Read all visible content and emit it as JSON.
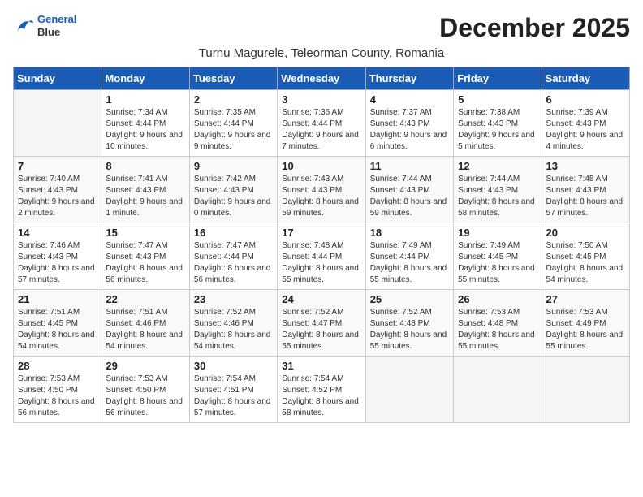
{
  "logo": {
    "line1": "General",
    "line2": "Blue"
  },
  "title": "December 2025",
  "location": "Turnu Magurele, Teleorman County, Romania",
  "weekdays": [
    "Sunday",
    "Monday",
    "Tuesday",
    "Wednesday",
    "Thursday",
    "Friday",
    "Saturday"
  ],
  "weeks": [
    [
      {
        "day": "",
        "sunrise": "",
        "sunset": "",
        "daylight": ""
      },
      {
        "day": "1",
        "sunrise": "Sunrise: 7:34 AM",
        "sunset": "Sunset: 4:44 PM",
        "daylight": "Daylight: 9 hours and 10 minutes."
      },
      {
        "day": "2",
        "sunrise": "Sunrise: 7:35 AM",
        "sunset": "Sunset: 4:44 PM",
        "daylight": "Daylight: 9 hours and 9 minutes."
      },
      {
        "day": "3",
        "sunrise": "Sunrise: 7:36 AM",
        "sunset": "Sunset: 4:44 PM",
        "daylight": "Daylight: 9 hours and 7 minutes."
      },
      {
        "day": "4",
        "sunrise": "Sunrise: 7:37 AM",
        "sunset": "Sunset: 4:43 PM",
        "daylight": "Daylight: 9 hours and 6 minutes."
      },
      {
        "day": "5",
        "sunrise": "Sunrise: 7:38 AM",
        "sunset": "Sunset: 4:43 PM",
        "daylight": "Daylight: 9 hours and 5 minutes."
      },
      {
        "day": "6",
        "sunrise": "Sunrise: 7:39 AM",
        "sunset": "Sunset: 4:43 PM",
        "daylight": "Daylight: 9 hours and 4 minutes."
      }
    ],
    [
      {
        "day": "7",
        "sunrise": "Sunrise: 7:40 AM",
        "sunset": "Sunset: 4:43 PM",
        "daylight": "Daylight: 9 hours and 2 minutes."
      },
      {
        "day": "8",
        "sunrise": "Sunrise: 7:41 AM",
        "sunset": "Sunset: 4:43 PM",
        "daylight": "Daylight: 9 hours and 1 minute."
      },
      {
        "day": "9",
        "sunrise": "Sunrise: 7:42 AM",
        "sunset": "Sunset: 4:43 PM",
        "daylight": "Daylight: 9 hours and 0 minutes."
      },
      {
        "day": "10",
        "sunrise": "Sunrise: 7:43 AM",
        "sunset": "Sunset: 4:43 PM",
        "daylight": "Daylight: 8 hours and 59 minutes."
      },
      {
        "day": "11",
        "sunrise": "Sunrise: 7:44 AM",
        "sunset": "Sunset: 4:43 PM",
        "daylight": "Daylight: 8 hours and 59 minutes."
      },
      {
        "day": "12",
        "sunrise": "Sunrise: 7:44 AM",
        "sunset": "Sunset: 4:43 PM",
        "daylight": "Daylight: 8 hours and 58 minutes."
      },
      {
        "day": "13",
        "sunrise": "Sunrise: 7:45 AM",
        "sunset": "Sunset: 4:43 PM",
        "daylight": "Daylight: 8 hours and 57 minutes."
      }
    ],
    [
      {
        "day": "14",
        "sunrise": "Sunrise: 7:46 AM",
        "sunset": "Sunset: 4:43 PM",
        "daylight": "Daylight: 8 hours and 57 minutes."
      },
      {
        "day": "15",
        "sunrise": "Sunrise: 7:47 AM",
        "sunset": "Sunset: 4:43 PM",
        "daylight": "Daylight: 8 hours and 56 minutes."
      },
      {
        "day": "16",
        "sunrise": "Sunrise: 7:47 AM",
        "sunset": "Sunset: 4:44 PM",
        "daylight": "Daylight: 8 hours and 56 minutes."
      },
      {
        "day": "17",
        "sunrise": "Sunrise: 7:48 AM",
        "sunset": "Sunset: 4:44 PM",
        "daylight": "Daylight: 8 hours and 55 minutes."
      },
      {
        "day": "18",
        "sunrise": "Sunrise: 7:49 AM",
        "sunset": "Sunset: 4:44 PM",
        "daylight": "Daylight: 8 hours and 55 minutes."
      },
      {
        "day": "19",
        "sunrise": "Sunrise: 7:49 AM",
        "sunset": "Sunset: 4:45 PM",
        "daylight": "Daylight: 8 hours and 55 minutes."
      },
      {
        "day": "20",
        "sunrise": "Sunrise: 7:50 AM",
        "sunset": "Sunset: 4:45 PM",
        "daylight": "Daylight: 8 hours and 54 minutes."
      }
    ],
    [
      {
        "day": "21",
        "sunrise": "Sunrise: 7:51 AM",
        "sunset": "Sunset: 4:45 PM",
        "daylight": "Daylight: 8 hours and 54 minutes."
      },
      {
        "day": "22",
        "sunrise": "Sunrise: 7:51 AM",
        "sunset": "Sunset: 4:46 PM",
        "daylight": "Daylight: 8 hours and 54 minutes."
      },
      {
        "day": "23",
        "sunrise": "Sunrise: 7:52 AM",
        "sunset": "Sunset: 4:46 PM",
        "daylight": "Daylight: 8 hours and 54 minutes."
      },
      {
        "day": "24",
        "sunrise": "Sunrise: 7:52 AM",
        "sunset": "Sunset: 4:47 PM",
        "daylight": "Daylight: 8 hours and 55 minutes."
      },
      {
        "day": "25",
        "sunrise": "Sunrise: 7:52 AM",
        "sunset": "Sunset: 4:48 PM",
        "daylight": "Daylight: 8 hours and 55 minutes."
      },
      {
        "day": "26",
        "sunrise": "Sunrise: 7:53 AM",
        "sunset": "Sunset: 4:48 PM",
        "daylight": "Daylight: 8 hours and 55 minutes."
      },
      {
        "day": "27",
        "sunrise": "Sunrise: 7:53 AM",
        "sunset": "Sunset: 4:49 PM",
        "daylight": "Daylight: 8 hours and 55 minutes."
      }
    ],
    [
      {
        "day": "28",
        "sunrise": "Sunrise: 7:53 AM",
        "sunset": "Sunset: 4:50 PM",
        "daylight": "Daylight: 8 hours and 56 minutes."
      },
      {
        "day": "29",
        "sunrise": "Sunrise: 7:53 AM",
        "sunset": "Sunset: 4:50 PM",
        "daylight": "Daylight: 8 hours and 56 minutes."
      },
      {
        "day": "30",
        "sunrise": "Sunrise: 7:54 AM",
        "sunset": "Sunset: 4:51 PM",
        "daylight": "Daylight: 8 hours and 57 minutes."
      },
      {
        "day": "31",
        "sunrise": "Sunrise: 7:54 AM",
        "sunset": "Sunset: 4:52 PM",
        "daylight": "Daylight: 8 hours and 58 minutes."
      },
      {
        "day": "",
        "sunrise": "",
        "sunset": "",
        "daylight": ""
      },
      {
        "day": "",
        "sunrise": "",
        "sunset": "",
        "daylight": ""
      },
      {
        "day": "",
        "sunrise": "",
        "sunset": "",
        "daylight": ""
      }
    ]
  ]
}
